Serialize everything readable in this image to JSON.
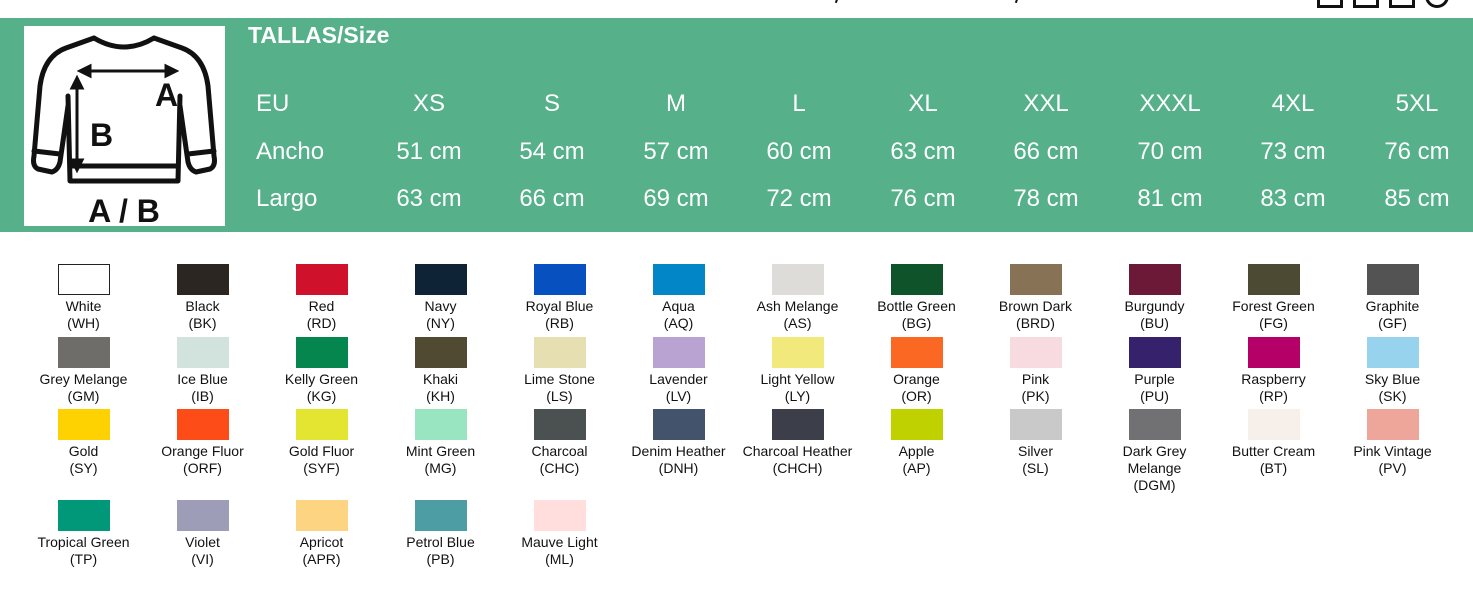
{
  "size_table": {
    "title": "TALLAS/Size",
    "garment_label": "A / B",
    "measure_a": "A",
    "measure_b": "B",
    "rows": [
      {
        "label": "EU",
        "values": [
          "XS",
          "S",
          "M",
          "L",
          "XL",
          "XXL",
          "XXXL",
          "4XL",
          "5XL"
        ]
      },
      {
        "label": "Ancho",
        "values": [
          "51 cm",
          "54 cm",
          "57 cm",
          "60 cm",
          "63 cm",
          "66 cm",
          "70 cm",
          "73 cm",
          "76 cm"
        ]
      },
      {
        "label": "Largo",
        "values": [
          "63 cm",
          "66 cm",
          "69 cm",
          "72 cm",
          "76 cm",
          "78 cm",
          "81 cm",
          "83 cm",
          "85 cm"
        ]
      }
    ],
    "banner_color": "#56b08a"
  },
  "colors": [
    {
      "name": "White",
      "code": "(WH)",
      "hex": "#ffffff"
    },
    {
      "name": "Black",
      "code": "(BK)",
      "hex": "#2b2622"
    },
    {
      "name": "Red",
      "code": "(RD)",
      "hex": "#d0112b"
    },
    {
      "name": "Navy",
      "code": "(NY)",
      "hex": "#0e2436"
    },
    {
      "name": "Royal Blue",
      "code": "(RB)",
      "hex": "#0650bf"
    },
    {
      "name": "Aqua",
      "code": "(AQ)",
      "hex": "#0386c7"
    },
    {
      "name": "Ash Melange",
      "code": "(AS)",
      "hex": "#dedcd9"
    },
    {
      "name": "Bottle Green",
      "code": "(BG)",
      "hex": "#0f532a"
    },
    {
      "name": "Brown Dark",
      "code": "(BRD)",
      "hex": "#877256"
    },
    {
      "name": "Burgundy",
      "code": "(BU)",
      "hex": "#6c1837"
    },
    {
      "name": "Forest Green",
      "code": "(FG)",
      "hex": "#4d4a33"
    },
    {
      "name": "Graphite",
      "code": "(GF)",
      "hex": "#535353"
    },
    {
      "name": "Grey Melange",
      "code": "(GM)",
      "hex": "#6f6d6a"
    },
    {
      "name": "Ice Blue",
      "code": "(IB)",
      "hex": "#d1e3dc"
    },
    {
      "name": "Kelly Green",
      "code": "(KG)",
      "hex": "#05864f"
    },
    {
      "name": "Khaki",
      "code": "(KH)",
      "hex": "#514a33"
    },
    {
      "name": "Lime Stone",
      "code": "(LS)",
      "hex": "#e6dfb2"
    },
    {
      "name": "Lavender",
      "code": "(LV)",
      "hex": "#b9a3d3"
    },
    {
      "name": "Light Yellow",
      "code": "(LY)",
      "hex": "#f2e97d"
    },
    {
      "name": "Orange",
      "code": "(OR)",
      "hex": "#fb6823"
    },
    {
      "name": "Pink",
      "code": "(PK)",
      "hex": "#f8dbe0"
    },
    {
      "name": "Purple",
      "code": "(PU)",
      "hex": "#36216d"
    },
    {
      "name": "Raspberry",
      "code": "(RP)",
      "hex": "#b50068"
    },
    {
      "name": "Sky Blue",
      "code": "(SK)",
      "hex": "#97d3ec"
    },
    {
      "name": "Gold",
      "code": "(SY)",
      "hex": "#fdd200"
    },
    {
      "name": "Orange Fluor",
      "code": "(ORF)",
      "hex": "#fe4c18"
    },
    {
      "name": "Gold Fluor",
      "code": "(SYF)",
      "hex": "#e3e531"
    },
    {
      "name": "Mint Green",
      "code": "(MG)",
      "hex": "#99e4c1"
    },
    {
      "name": "Charcoal",
      "code": "(CHC)",
      "hex": "#4b5050"
    },
    {
      "name": "Denim Heather",
      "code": "(DNH)",
      "hex": "#42536b"
    },
    {
      "name": "Charcoal Heather",
      "code": "(CHCH)",
      "hex": "#3c3f4a"
    },
    {
      "name": "Apple",
      "code": "(AP)",
      "hex": "#c0d100"
    },
    {
      "name": "Silver",
      "code": "(SL)",
      "hex": "#c9c9c9"
    },
    {
      "name": "Dark Grey Melange",
      "code": "(DGM)",
      "hex": "#717173"
    },
    {
      "name": "Butter Cream",
      "code": "(BT)",
      "hex": "#f6efea"
    },
    {
      "name": "Pink Vintage",
      "code": "(PV)",
      "hex": "#eea69a"
    },
    {
      "name": "Tropical Green",
      "code": "(TP)",
      "hex": "#019879"
    },
    {
      "name": "Violet",
      "code": "(VI)",
      "hex": "#9e9db7"
    },
    {
      "name": "Apricot",
      "code": "(APR)",
      "hex": "#fdd482"
    },
    {
      "name": "Petrol Blue",
      "code": "(PB)",
      "hex": "#4d9da5"
    },
    {
      "name": "Mauve Light",
      "code": "(ML)",
      "hex": "#ffdedd"
    }
  ]
}
